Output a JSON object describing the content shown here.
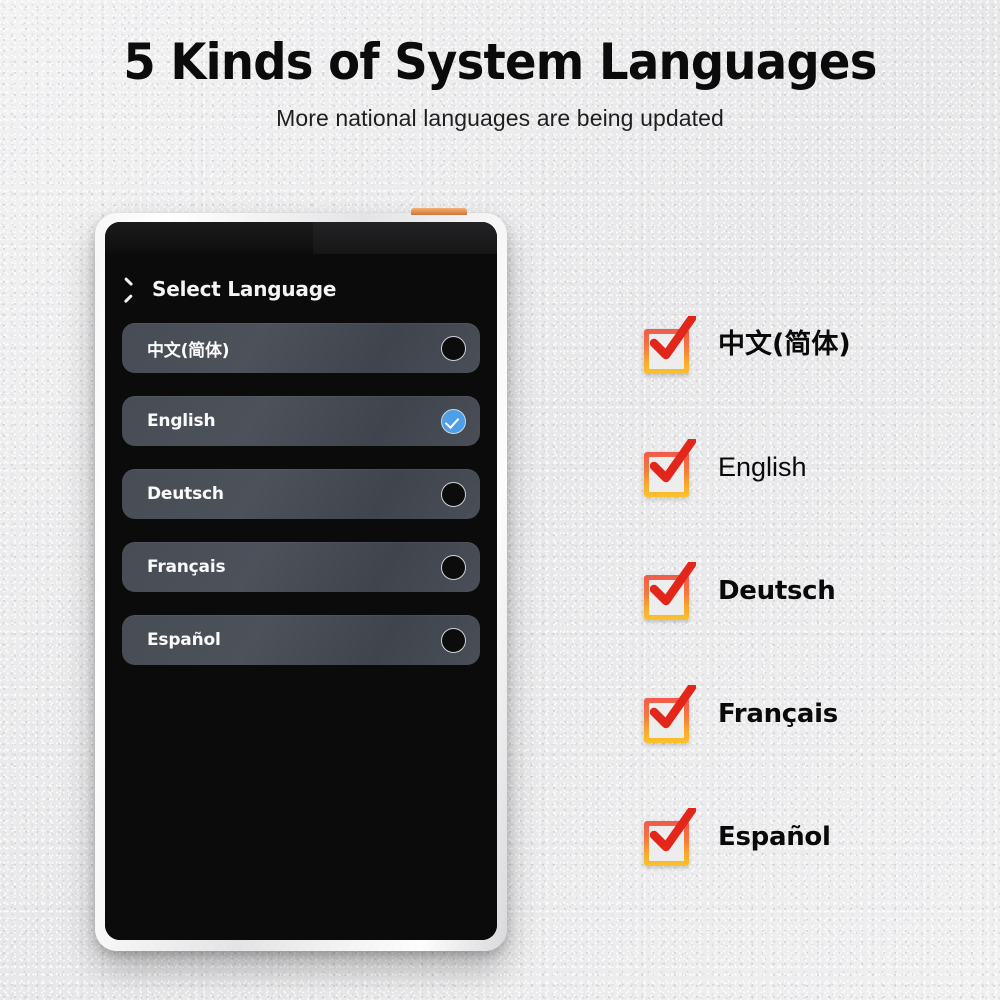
{
  "header": {
    "title": "5 Kinds of System Languages",
    "subtitle": "More national languages are being updated"
  },
  "device": {
    "power_button_name": "power-button",
    "screen": {
      "back_icon": "back-chevron-icon",
      "title": "Select Language",
      "languages": [
        {
          "label": "中文(简体)",
          "selected": false,
          "indicator": "radio-unselected"
        },
        {
          "label": "English",
          "selected": true,
          "indicator": "radio-selected-check"
        },
        {
          "label": "Deutsch",
          "selected": false,
          "indicator": "radio-unselected"
        },
        {
          "label": "Français",
          "selected": false,
          "indicator": "radio-unselected"
        },
        {
          "label": "Español",
          "selected": false,
          "indicator": "radio-unselected"
        }
      ]
    }
  },
  "checklist": {
    "icon_name": "checked-checkbox-icon",
    "items": [
      {
        "label": "中文(简体)",
        "style": "style-cjk"
      },
      {
        "label": "English",
        "style": "style-regular"
      },
      {
        "label": "Deutsch",
        "style": "style-geometric"
      },
      {
        "label": "Français",
        "style": "style-geometric"
      },
      {
        "label": "Español",
        "style": "style-geometric"
      }
    ]
  },
  "colors": {
    "page_background": "#ececed",
    "title_text": "#0b0b0b",
    "screen_background": "#0b0b0c",
    "row_background": "#474c55",
    "row_text": "#fafafa",
    "selected_indicator": "#4d9fe8",
    "checkbox_gradient_top": "#f2594b",
    "checkbox_gradient_bottom": "#fbc22c",
    "checkmark": "#e3261a",
    "power_button": "#df8d4e",
    "device_frame": "#ffffff"
  }
}
